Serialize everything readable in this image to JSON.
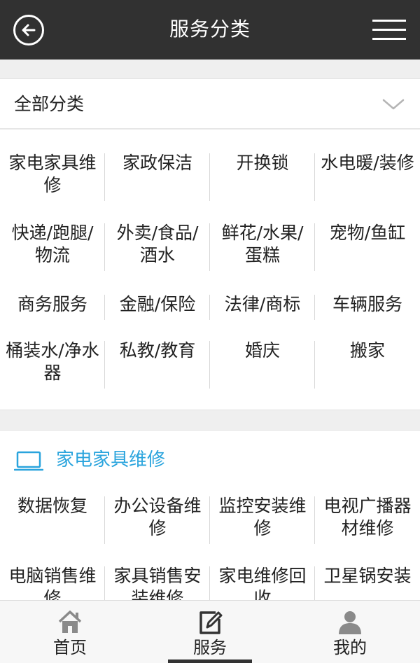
{
  "header": {
    "title": "服务分类"
  },
  "all_section": {
    "label": "全部分类",
    "items": [
      [
        "家电家具维",
        "修"
      ],
      [
        "家政保洁"
      ],
      [
        "开换锁"
      ],
      [
        "水电暖/装修"
      ],
      [
        "快递/跑腿/",
        "物流"
      ],
      [
        "外卖/食品/",
        "酒水"
      ],
      [
        "鲜花/水果/",
        "蛋糕"
      ],
      [
        "宠物/鱼缸"
      ],
      [
        "商务服务"
      ],
      [
        "金融/保险"
      ],
      [
        "法律/商标"
      ],
      [
        "车辆服务"
      ],
      [
        "桶装水/净水",
        "器"
      ],
      [
        "私教/教育"
      ],
      [
        "婚庆"
      ],
      [
        "搬家"
      ]
    ]
  },
  "category_section": {
    "title": "家电家具维修",
    "items": [
      [
        "数据恢复"
      ],
      [
        "办公设备维",
        "修"
      ],
      [
        "监控安装维",
        "修"
      ],
      [
        "电视广播器",
        "材维修"
      ],
      [
        "电脑销售维",
        "修"
      ],
      [
        "家具销售安",
        "装维修"
      ],
      [
        "家电维修回",
        "收"
      ],
      [
        "卫星锅安装"
      ]
    ]
  },
  "tabbar": {
    "home": "首页",
    "service": "服务",
    "mine": "我的"
  },
  "colors": {
    "header_bg": "#313131",
    "accent": "#2aa4dd",
    "icon_gray": "#8a8a8a"
  }
}
